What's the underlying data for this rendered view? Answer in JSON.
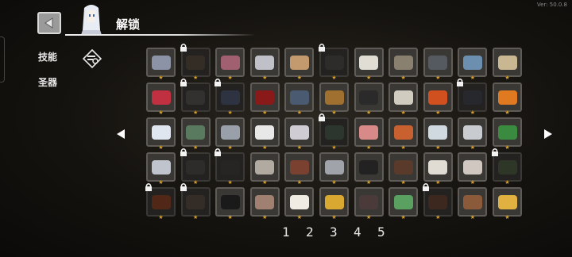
{
  "version": "Ver: 50.0.8",
  "header": {
    "title": "解锁"
  },
  "sidebar": {
    "tabs": [
      {
        "label": "技能"
      },
      {
        "label": "圣器"
      }
    ]
  },
  "colors": {
    "star": "#d9a028",
    "slot_border": "#5f5c57",
    "slot_bg": "#3a3835",
    "locked_bg": "#232220"
  },
  "items": [
    {
      "icon": "crystal-shard",
      "color": "#8d93a6",
      "locked": false
    },
    {
      "icon": "dark-pouch",
      "color": "#4a3b2e",
      "locked": true
    },
    {
      "icon": "meat-ring",
      "color": "#a06070",
      "locked": false
    },
    {
      "icon": "claws",
      "color": "#c0c0c8",
      "locked": false
    },
    {
      "icon": "bandage",
      "color": "#c29a6e",
      "locked": false
    },
    {
      "icon": "black-feather",
      "color": "#3a3a3a",
      "locked": true
    },
    {
      "icon": "white-fan",
      "color": "#e0ddd5",
      "locked": false
    },
    {
      "icon": "bone-club",
      "color": "#8a8070",
      "locked": false
    },
    {
      "icon": "frying-pan",
      "color": "#555a60",
      "locked": false
    },
    {
      "icon": "sapphire-ring",
      "color": "#6c8fb0",
      "locked": false
    },
    {
      "icon": "scroll",
      "color": "#c9b792",
      "locked": false
    },
    {
      "icon": "magnet",
      "color": "#c03040",
      "locked": false
    },
    {
      "icon": "rod",
      "color": "#444444",
      "locked": true
    },
    {
      "icon": "skull-mask",
      "color": "#3a4a6a",
      "locked": true
    },
    {
      "icon": "blood-heart",
      "color": "#8a1a1a",
      "locked": false
    },
    {
      "icon": "snake-coil",
      "color": "#4a5a70",
      "locked": false
    },
    {
      "icon": "acorn",
      "color": "#a07030",
      "locked": false
    },
    {
      "icon": "top-hat",
      "color": "#2a2a2a",
      "locked": false
    },
    {
      "icon": "bone",
      "color": "#d0ccc0",
      "locked": false
    },
    {
      "icon": "fire-orb",
      "color": "#d05020",
      "locked": false
    },
    {
      "icon": "bomb",
      "color": "#2a3040",
      "locked": true
    },
    {
      "icon": "carrot",
      "color": "#e07a20",
      "locked": false
    },
    {
      "icon": "white-wing",
      "color": "#dfe6f0",
      "locked": false
    },
    {
      "icon": "green-slime",
      "color": "#5a7a60",
      "locked": false
    },
    {
      "icon": "stone-altar",
      "color": "#9aa0aa",
      "locked": false
    },
    {
      "icon": "dark-book",
      "color": "#e8e8e8",
      "locked": false
    },
    {
      "icon": "open-book",
      "color": "#d0ccd4",
      "locked": false
    },
    {
      "icon": "green-tray",
      "color": "#3a5040",
      "locked": true
    },
    {
      "icon": "ham",
      "color": "#d88a88",
      "locked": false
    },
    {
      "icon": "roast-meat",
      "color": "#c86030",
      "locked": false
    },
    {
      "icon": "shuriken",
      "color": "#d0d8e0",
      "locked": false
    },
    {
      "icon": "pills",
      "color": "#c8ccd0",
      "locked": false
    },
    {
      "icon": "green-peas",
      "color": "#3a8a40",
      "locked": false
    },
    {
      "icon": "silver-ghost",
      "color": "#c0c4cc",
      "locked": false
    },
    {
      "icon": "dark-disc",
      "color": "#3a3a3a",
      "locked": true
    },
    {
      "icon": "black-hook",
      "color": "#2a2a2a",
      "locked": true
    },
    {
      "icon": "crossbow",
      "color": "#b0aaa0",
      "locked": false
    },
    {
      "icon": "frying-spoon",
      "color": "#7a4030",
      "locked": false
    },
    {
      "icon": "dagger",
      "color": "#a0a4aa",
      "locked": false
    },
    {
      "icon": "black-blade",
      "color": "#222222",
      "locked": false
    },
    {
      "icon": "brown-stone",
      "color": "#5a3a2a",
      "locked": false
    },
    {
      "icon": "chess-knight",
      "color": "#e0dcd4",
      "locked": false
    },
    {
      "icon": "skull-cards",
      "color": "#d0c8c0",
      "locked": false
    },
    {
      "icon": "green-cloth",
      "color": "#3a5030",
      "locked": true
    },
    {
      "icon": "ember-ash",
      "color": "#8a3010",
      "locked": true
    },
    {
      "icon": "bead-chain",
      "color": "#4a3a30",
      "locked": true
    },
    {
      "icon": "sunglasses",
      "color": "#1a1a1a",
      "locked": false
    },
    {
      "icon": "crocodile",
      "color": "#a08070",
      "locked": false
    },
    {
      "icon": "white-rabbit",
      "color": "#f0ece4",
      "locked": false
    },
    {
      "icon": "golden-snake",
      "color": "#d8a830",
      "locked": false
    },
    {
      "icon": "pouch-sack",
      "color": "#4a3a3a",
      "locked": false
    },
    {
      "icon": "green-dragon",
      "color": "#5aa060",
      "locked": false
    },
    {
      "icon": "wand-stick",
      "color": "#5a3020",
      "locked": true
    },
    {
      "icon": "brown-tome",
      "color": "#8a5a3a",
      "locked": false
    },
    {
      "icon": "gold-coins",
      "color": "#e0b040",
      "locked": false
    }
  ],
  "pagination": {
    "pages": [
      "1",
      "2",
      "3",
      "4",
      "5"
    ]
  }
}
